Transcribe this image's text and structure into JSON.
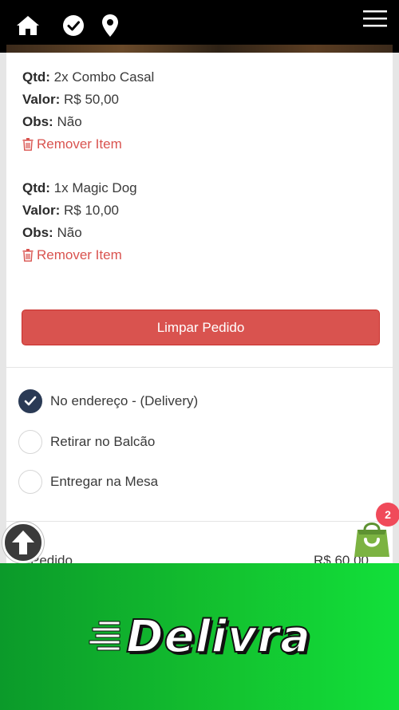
{
  "cart_items": [
    {
      "qtd_label": "Qtd:",
      "qtd_value": "2x Combo Casal",
      "valor_label": "Valor:",
      "valor_value": "R$ 50,00",
      "obs_label": "Obs:",
      "obs_value": "Não",
      "remove_label": "Remover Item"
    },
    {
      "qtd_label": "Qtd:",
      "qtd_value": "1x Magic Dog",
      "valor_label": "Valor:",
      "valor_value": "R$ 10,00",
      "obs_label": "Obs:",
      "obs_value": "Não",
      "remove_label": "Remover Item"
    }
  ],
  "clear_button_label": "Limpar Pedido",
  "delivery_options": [
    {
      "label": "No endereço - (Delivery)",
      "checked": true
    },
    {
      "label": "Retirar no Balcão",
      "checked": false
    },
    {
      "label": "Entregar na Mesa",
      "checked": false
    }
  ],
  "summary": {
    "label": "Pedido",
    "value": "R$ 60,00"
  },
  "cart_badge_count": "2",
  "brand": "Delivra",
  "colors": {
    "danger": "#d9534f",
    "radio_checked": "#2a3a55",
    "banner_green": "#13c12f",
    "badge": "#f04a5a"
  },
  "icons": [
    "home-icon",
    "check-circle-icon",
    "map-pin-icon",
    "hamburger-menu-icon",
    "trash-icon",
    "check-icon",
    "arrow-up-icon",
    "shopping-bag-icon"
  ]
}
